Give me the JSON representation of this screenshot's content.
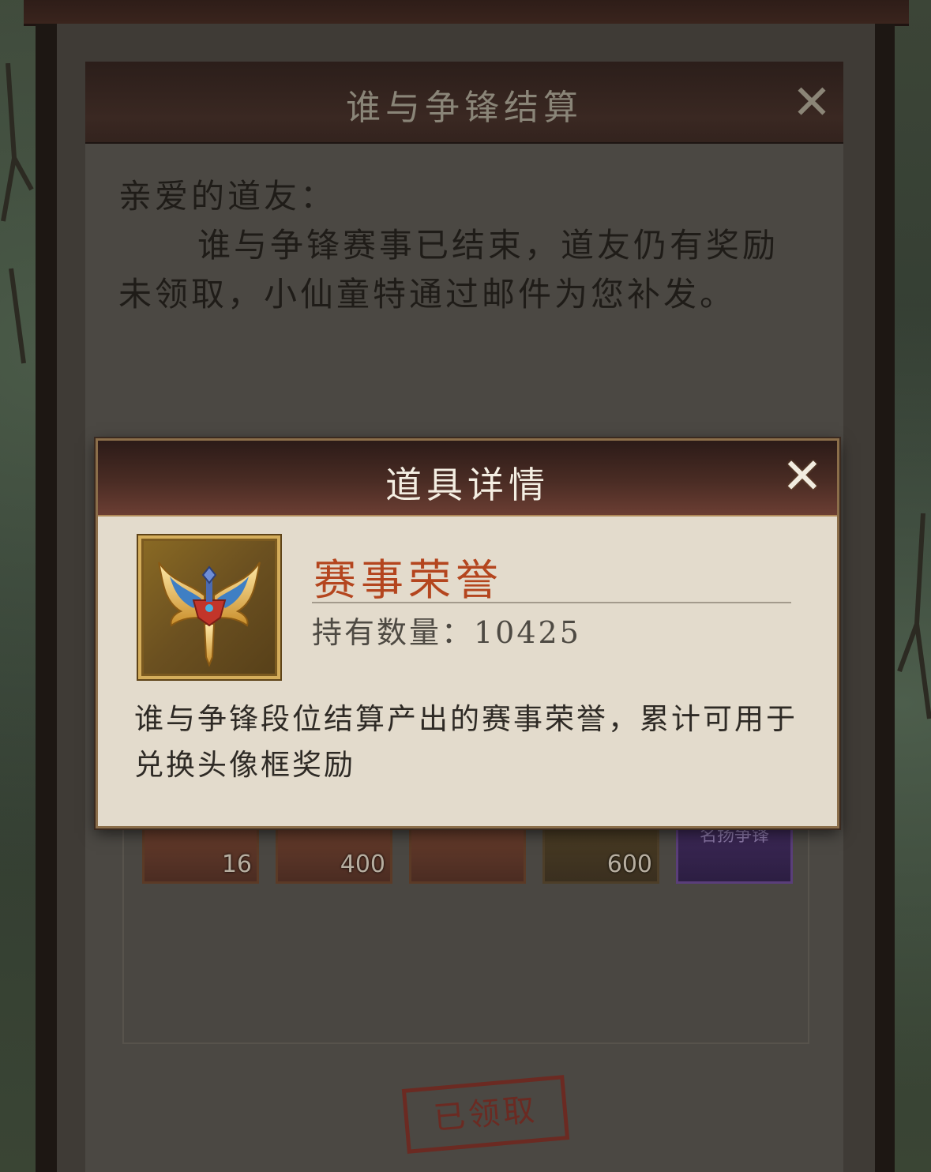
{
  "mail": {
    "title": "谁与争锋结算",
    "greeting": "亲爱的道友：",
    "paragraph": "谁与争锋赛事已结束，道友仍有奖励未领取，小仙童特通过邮件为您补发。",
    "close_glyph": "✕",
    "rewards": [
      {
        "count": "16"
      },
      {
        "count": "400"
      },
      {
        "count": ""
      },
      {
        "count": "600"
      },
      {
        "label": "名扬争锋"
      }
    ],
    "claimed_stamp": "已领取"
  },
  "dialog": {
    "title": "道具详情",
    "close_glyph": "✕",
    "item": {
      "icon": "winged-sword-emblem-icon",
      "name": "赛事荣誉",
      "quantity_text": "持有数量：10425",
      "description": "谁与争锋段位结算产出的赛事荣誉，累计可用于兑换头像框奖励"
    }
  },
  "colors": {
    "item_name": "#b4451e",
    "dialog_bg": "#e3dbcc",
    "header_dark": "#2c1b18",
    "icon_border": "#d4ad5b"
  }
}
